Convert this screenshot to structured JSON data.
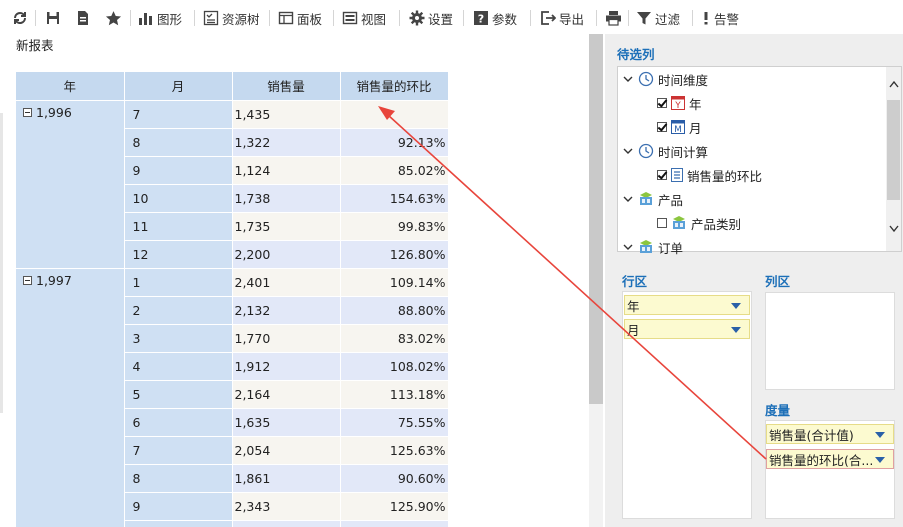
{
  "toolbar": {
    "chart_label": "图形",
    "resource_tree_label": "资源树",
    "panel_label": "面板",
    "view_label": "视图",
    "settings_label": "设置",
    "params_label": "参数",
    "export_label": "导出",
    "filter_label": "过滤",
    "alert_label": "告警"
  },
  "report": {
    "title": "新报表",
    "headers": [
      "年",
      "月",
      "销售量",
      "销售量的环比"
    ],
    "groups": [
      {
        "year": "1,996",
        "rows": [
          {
            "month": "7",
            "sales": "1,435",
            "ratio": ""
          },
          {
            "month": "8",
            "sales": "1,322",
            "ratio": "92.13%"
          },
          {
            "month": "9",
            "sales": "1,124",
            "ratio": "85.02%"
          },
          {
            "month": "10",
            "sales": "1,738",
            "ratio": "154.63%"
          },
          {
            "month": "11",
            "sales": "1,735",
            "ratio": "99.83%"
          },
          {
            "month": "12",
            "sales": "2,200",
            "ratio": "126.80%"
          }
        ]
      },
      {
        "year": "1,997",
        "rows": [
          {
            "month": "1",
            "sales": "2,401",
            "ratio": "109.14%"
          },
          {
            "month": "2",
            "sales": "2,132",
            "ratio": "88.80%"
          },
          {
            "month": "3",
            "sales": "1,770",
            "ratio": "83.02%"
          },
          {
            "month": "4",
            "sales": "1,912",
            "ratio": "108.02%"
          },
          {
            "month": "5",
            "sales": "2,164",
            "ratio": "113.18%"
          },
          {
            "month": "6",
            "sales": "1,635",
            "ratio": "75.55%"
          },
          {
            "month": "7",
            "sales": "2,054",
            "ratio": "125.63%"
          },
          {
            "month": "8",
            "sales": "1,861",
            "ratio": "90.60%"
          },
          {
            "month": "9",
            "sales": "2,343",
            "ratio": "125.90%"
          },
          {
            "month": "",
            "sales": "",
            "ratio": ""
          }
        ]
      }
    ]
  },
  "candidates": {
    "title": "待选列",
    "tree": [
      {
        "label": "时间维度",
        "level": 0,
        "expanded": true,
        "checkbox": null,
        "icon": "clock-dimension-icon"
      },
      {
        "label": "年",
        "level": 1,
        "checkbox": true,
        "icon": "year-icon"
      },
      {
        "label": "月",
        "level": 1,
        "checkbox": true,
        "icon": "month-icon"
      },
      {
        "label": "时间计算",
        "level": 0,
        "expanded": true,
        "checkbox": null,
        "icon": "clock-calc-icon"
      },
      {
        "label": "销售量的环比",
        "level": 1,
        "checkbox": true,
        "icon": "measure-doc-icon"
      },
      {
        "label": "产品",
        "level": 0,
        "expanded": true,
        "checkbox": null,
        "icon": "dimension-icon"
      },
      {
        "label": "产品类别",
        "level": 1,
        "checkbox": false,
        "icon": "dimension-icon"
      },
      {
        "label": "订单",
        "level": 0,
        "expanded": true,
        "checkbox": null,
        "icon": "dimension-icon"
      }
    ]
  },
  "row_zone": {
    "title": "行区",
    "items": [
      "年",
      "月"
    ]
  },
  "column_zone": {
    "title": "列区",
    "items": []
  },
  "measure_zone": {
    "title": "度量",
    "items": [
      "销售量(合计值)",
      "销售量的环比(合..."
    ]
  },
  "colors": {
    "accent": "#1c6fb8",
    "header_bg": "#c5d9ef",
    "chip_bg": "#fcfad0",
    "arrow": "#e8453c"
  }
}
